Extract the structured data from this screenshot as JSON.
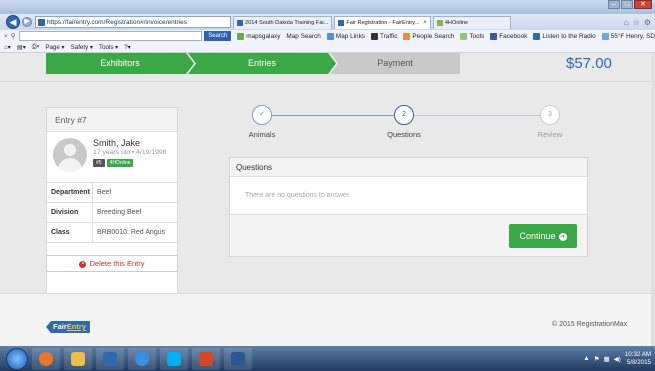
{
  "browser": {
    "address": "https://fairentry.com/Registration#/invoice/entries",
    "tabs": [
      {
        "label": "2014 South Dakota Training Fai..."
      },
      {
        "label": "Fair Registration - FairEntry..."
      },
      {
        "label": "4HOnline"
      }
    ],
    "search_button": "Search",
    "toolbar_items": [
      "mapsgalaxy",
      "Map Search",
      "Map Links",
      "Traffic",
      "People Search",
      "Tools",
      "Facebook",
      "Listen to the Radio",
      "55°F Henry, SD"
    ],
    "command_items": [
      "Page ▾",
      "Safety ▾",
      "Tools ▾"
    ]
  },
  "steps": [
    "Exhibitors",
    "Entries",
    "Payment"
  ],
  "total": "$57.00",
  "entry": {
    "title": "Entry #7",
    "name": "Smith, Jake",
    "meta": "17 years old • 4/19/1998",
    "badges": [
      "#5",
      "4HOnline"
    ],
    "details": [
      {
        "label": "Department",
        "value": "Beef"
      },
      {
        "label": "Division",
        "value": "Breeding Beef"
      },
      {
        "label": "Class",
        "value": "BRB0010: Red Angus"
      }
    ],
    "delete_label": "Delete this Entry"
  },
  "progress": [
    {
      "number": "✓",
      "label": "Animals"
    },
    {
      "number": "2",
      "label": "Questions"
    },
    {
      "number": "3",
      "label": "Review"
    }
  ],
  "questions": {
    "title": "Questions",
    "empty_text": "There are no questions to answer.",
    "continue_label": "Continue"
  },
  "footer": {
    "logo_prefix": "Fair",
    "logo_suffix": "Entry",
    "copyright": "© 2015 RegistrationMax"
  },
  "taskbar": {
    "time": "10:32 AM",
    "date": "5/8/2015"
  }
}
